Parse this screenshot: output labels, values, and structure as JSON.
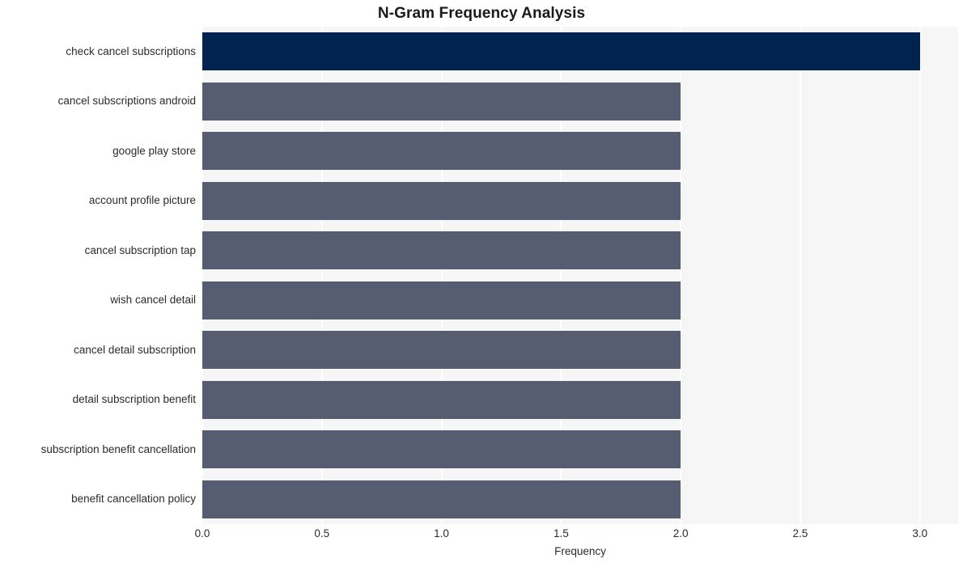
{
  "chart_data": {
    "type": "bar",
    "orientation": "horizontal",
    "title": "N-Gram Frequency Analysis",
    "xlabel": "Frequency",
    "ylabel": "",
    "categories": [
      "check cancel subscriptions",
      "cancel subscriptions android",
      "google play store",
      "account profile picture",
      "cancel subscription tap",
      "wish cancel detail",
      "cancel detail subscription",
      "detail subscription benefit",
      "subscription benefit cancellation",
      "benefit cancellation policy"
    ],
    "values": [
      3,
      2,
      2,
      2,
      2,
      2,
      2,
      2,
      2,
      2
    ],
    "xlim": [
      0.0,
      3.16
    ],
    "xticks": [
      0.0,
      0.5,
      1.0,
      1.5,
      2.0,
      2.5,
      3.0
    ],
    "xticklabels": [
      "0.0",
      "0.5",
      "1.0",
      "1.5",
      "2.0",
      "2.5",
      "3.0"
    ],
    "grid": true,
    "grid_axis": "x",
    "legend": false,
    "bar_colors": [
      "#002350",
      "#575d70",
      "#575d70",
      "#575d70",
      "#575d70",
      "#575d70",
      "#575d70",
      "#575d70",
      "#575d70",
      "#575d70"
    ],
    "colors": {
      "highlight": "#002350",
      "default_bar": "#575d70",
      "plot_background": "#f6f6f7",
      "figure_background": "#ffffff",
      "gridline": "#ffffff",
      "text": "#2b2b2b",
      "title_text": "#1a1a1a"
    }
  }
}
